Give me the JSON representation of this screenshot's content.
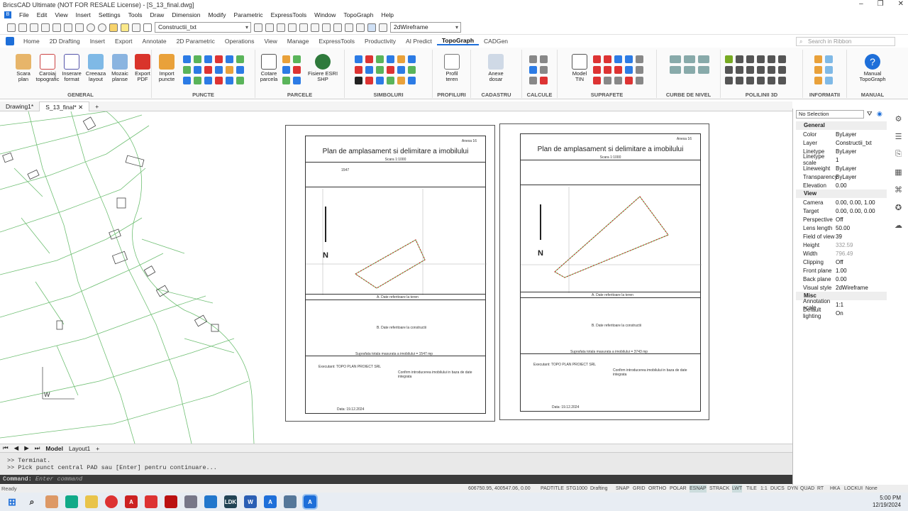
{
  "window": {
    "title": "BricsCAD Ultimate (NOT FOR RESALE License) - [S_13_final.dwg]"
  },
  "menu": [
    "File",
    "Edit",
    "View",
    "Insert",
    "Settings",
    "Tools",
    "Draw",
    "Dimension",
    "Modify",
    "Parametric",
    "ExpressTools",
    "Window",
    "TopoGraph",
    "Help"
  ],
  "qat": {
    "layer": "Constructii_txt",
    "visualstyle": "2dWireframe"
  },
  "ribbon_tabs": [
    "Home",
    "2D Drafting",
    "Insert",
    "Export",
    "Annotate",
    "2D Parametric",
    "Operations",
    "View",
    "Manage",
    "ExpressTools",
    "Productivity",
    "AI Predict",
    "TopoGraph",
    "CADGen"
  ],
  "ribbon_search": "Search in Ribbon",
  "panels": {
    "general": {
      "label": "GENERAL",
      "buttons": [
        "Scara plan",
        "Caroiaj topografic",
        "Inserare format",
        "Creeaza layout",
        "Mozaic planse",
        "Export PDF"
      ]
    },
    "puncte": {
      "label": "PUNCTE",
      "buttons": [
        "Import puncte"
      ]
    },
    "parcele": {
      "label": "PARCELE",
      "buttons": [
        "Cotare parcela",
        "Fisiere ESRI SHP"
      ]
    },
    "simboluri": {
      "label": "SIMBOLURI"
    },
    "profiluri": {
      "label": "PROFILURI",
      "buttons": [
        "Profil teren"
      ]
    },
    "cadastru": {
      "label": "CADASTRU",
      "buttons": [
        "Anexe dosar"
      ]
    },
    "calcule": {
      "label": "CALCULE"
    },
    "suprafete": {
      "label": "SUPRAFETE",
      "buttons": [
        "Model TIN"
      ]
    },
    "curbe": {
      "label": "CURBE DE NIVEL"
    },
    "polilinii": {
      "label": "POLILINII 3D"
    },
    "informatii": {
      "label": "INFORMATII"
    },
    "manual": {
      "label": "MANUAL",
      "buttons": [
        "Manual TopoGraph"
      ]
    }
  },
  "doc_tabs": [
    "Drawing1*",
    "S_13_final*"
  ],
  "sheets": {
    "title": "Plan de amplasament si delimitare a imobilului",
    "scale": "Scara 1:1000",
    "left": {
      "annex": "Anexa 16",
      "area": "1547",
      "area_sum": "Suprafata totala masurata a imobilului = 1547 mp",
      "date": "Data: 19.12.2024"
    },
    "right": {
      "annex": "Anexa 16",
      "area_sum": "Suprafata totala masurata a imobilului = 3743 mp",
      "date": "Data: 19.12.2024"
    },
    "section_a": "A. Date referitoare la teren",
    "section_b": "B. Date referitoare la constructii",
    "executant": "Executant: TOPO PLAN PROIECT SRL",
    "confirm": "Confirm introducerea imobilului in baza de date integrata",
    "north": "N"
  },
  "layout_tabs": [
    "Model",
    "Layout1"
  ],
  "cmd": {
    "history": [
      ">> Terminat.",
      ">> Pick punct central PAD sau [Enter] pentru continuare..."
    ],
    "prompt": "Command:",
    "placeholder": "Enter command"
  },
  "status": {
    "ready": "Ready",
    "coords": "606750.95, 400547.06, 0.00",
    "items": [
      "PADTITLE",
      "STG1000",
      "Drafting",
      "SNAP",
      "GRID",
      "ORTHO",
      "POLAR",
      "ESNAP",
      "STRACK",
      "LWT",
      "TILE",
      "1:1",
      "DUCS",
      "DYN",
      "QUAD",
      "RT",
      "HKA",
      "LOCKUI",
      "None"
    ]
  },
  "properties": {
    "selection": "No Selection",
    "general_header": "General",
    "general": [
      [
        "Color",
        "ByLayer"
      ],
      [
        "Layer",
        "Constructii_txt"
      ],
      [
        "Linetype",
        "ByLayer"
      ],
      [
        "Linetype scale",
        "1"
      ],
      [
        "Lineweight",
        "ByLayer"
      ],
      [
        "Transparency",
        "ByLayer"
      ],
      [
        "Elevation",
        "0.00"
      ]
    ],
    "view_header": "View",
    "view": [
      [
        "Camera",
        "0.00, 0.00, 1.00"
      ],
      [
        "Target",
        "0.00, 0.00, 0.00"
      ],
      [
        "Perspective",
        "Off"
      ],
      [
        "Lens length",
        "50.00"
      ],
      [
        "Field of view",
        "39"
      ],
      [
        "Height",
        "332.59"
      ],
      [
        "Width",
        "796.49"
      ],
      [
        "Clipping",
        "Off"
      ],
      [
        "Front plane",
        "1.00"
      ],
      [
        "Back plane",
        "0.00"
      ],
      [
        "Visual style",
        "2dWireframe"
      ]
    ],
    "misc_header": "Misc",
    "misc": [
      [
        "Annotation scale",
        "1:1"
      ],
      [
        "Default lighting",
        "On"
      ]
    ]
  },
  "clock": {
    "time": "5:00 PM",
    "date": "12/19/2024"
  }
}
